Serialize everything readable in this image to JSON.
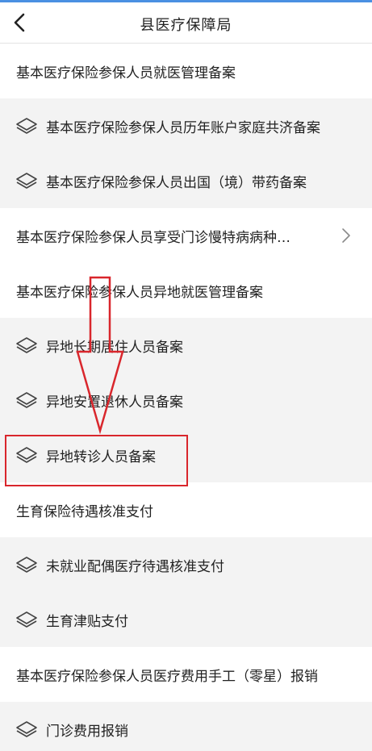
{
  "header": {
    "title": "县医疗保障局",
    "back_icon": "back-arrow-icon"
  },
  "rows": [
    {
      "type": "category",
      "label": "基本医疗保险参保人员就医管理备案"
    },
    {
      "type": "item",
      "icon": "layers-icon",
      "label": "基本医疗保险参保人员历年账户家庭共济备案"
    },
    {
      "type": "item",
      "icon": "layers-icon",
      "label": "基本医疗保险参保人员出国（境）带药备案"
    },
    {
      "type": "category",
      "label": "基本医疗保险参保人员享受门诊慢特病病种…",
      "has_chevron": true
    },
    {
      "type": "category",
      "label": "基本医疗保险参保人员异地就医管理备案"
    },
    {
      "type": "item",
      "icon": "layers-icon",
      "label": "异地长期居住人员备案"
    },
    {
      "type": "item",
      "icon": "layers-icon",
      "label": "异地安置退休人员备案"
    },
    {
      "type": "item",
      "icon": "layers-icon",
      "label": "异地转诊人员备案",
      "highlighted": true
    },
    {
      "type": "category",
      "label": "生育保险待遇核准支付"
    },
    {
      "type": "item",
      "icon": "layers-icon",
      "label": "未就业配偶医疗待遇核准支付"
    },
    {
      "type": "item",
      "icon": "layers-icon",
      "label": "生育津贴支付"
    },
    {
      "type": "category",
      "label": "基本医疗保险参保人员医疗费用手工（零星）报销"
    },
    {
      "type": "item",
      "icon": "layers-icon",
      "label": "门诊费用报销"
    }
  ],
  "colors": {
    "accent": "#4a90e2",
    "annotation": "#d9262c",
    "sub_row_bg": "#f3f3f3"
  }
}
